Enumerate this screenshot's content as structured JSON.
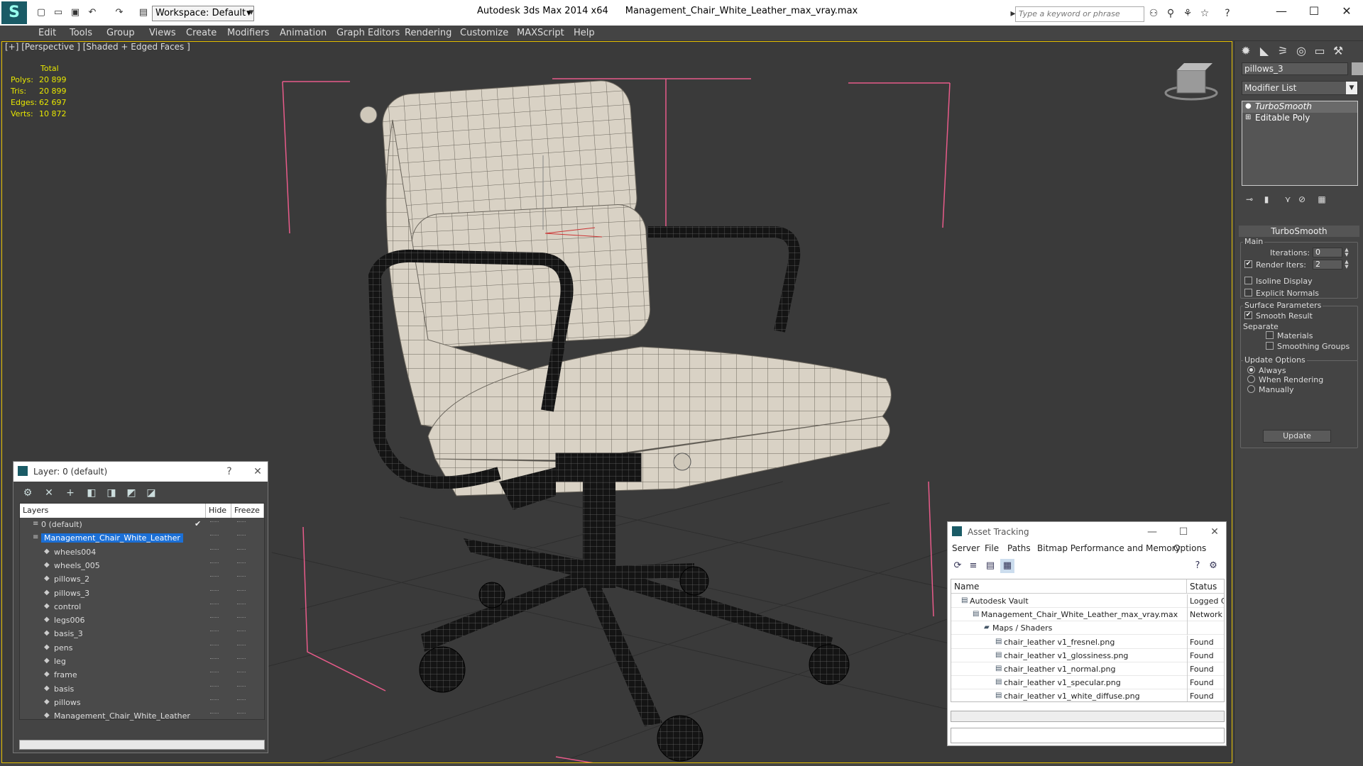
{
  "title_bar": {
    "app": "Autodesk 3ds Max  2014 x64",
    "file": "Management_Chair_White_Leather_max_vray.max",
    "workspace": "Workspace: Default",
    "search_placeholder": "Type a keyword or phrase"
  },
  "menu": [
    "Edit",
    "Tools",
    "Group",
    "Views",
    "Create",
    "Modifiers",
    "Animation",
    "Graph Editors",
    "Rendering",
    "Customize",
    "MAXScript",
    "Help"
  ],
  "viewport": {
    "label": "[+] [Perspective ] [Shaded + Edged Faces ]",
    "stats": {
      "header": "Total",
      "rows": [
        {
          "k": "Polys:",
          "v": "20 899"
        },
        {
          "k": "Tris:",
          "v": "20 899"
        },
        {
          "k": "Edges:",
          "v": "62 697"
        },
        {
          "k": "Verts:",
          "v": "10 872"
        }
      ]
    }
  },
  "command_panel": {
    "object_name": "pillows_3",
    "modifier_list": "Modifier List",
    "stack": [
      "TurboSmooth",
      "Editable Poly"
    ],
    "rollout_title": "TurboSmooth",
    "main_group": "Main",
    "iterations_label": "Iterations:",
    "iterations_value": "0",
    "render_iters_label": "Render Iters:",
    "render_iters_value": "2",
    "isoline": "Isoline Display",
    "explicit_normals": "Explicit Normals",
    "surface_group": "Surface Parameters",
    "smooth_result": "Smooth Result",
    "separate": "Separate",
    "materials": "Materials",
    "smoothing_groups": "Smoothing Groups",
    "update_group": "Update Options",
    "always": "Always",
    "when_rendering": "When Rendering",
    "manually": "Manually",
    "update_btn": "Update"
  },
  "layer_dialog": {
    "title": "Layer: 0 (default)",
    "help": "?",
    "columns": [
      "Layers",
      "Hide",
      "Freeze"
    ],
    "rows": [
      {
        "name": "0 (default)",
        "level": 0
      },
      {
        "name": "Management_Chair_White_Leather",
        "level": 0
      },
      {
        "name": "wheels004",
        "level": 1
      },
      {
        "name": "wheels_005",
        "level": 1
      },
      {
        "name": "pillows_2",
        "level": 1
      },
      {
        "name": "pillows_3",
        "level": 1
      },
      {
        "name": "control",
        "level": 1
      },
      {
        "name": "legs006",
        "level": 1
      },
      {
        "name": "basis_3",
        "level": 1
      },
      {
        "name": "pens",
        "level": 1
      },
      {
        "name": "leg",
        "level": 1
      },
      {
        "name": "frame",
        "level": 1
      },
      {
        "name": "basis",
        "level": 1
      },
      {
        "name": "pillows",
        "level": 1
      },
      {
        "name": "Management_Chair_White_Leather",
        "level": 1
      }
    ]
  },
  "asset_dialog": {
    "title": "Asset Tracking",
    "menu": [
      "Server",
      "File",
      "Paths",
      "Bitmap Performance and Memory",
      "Options"
    ],
    "columns": [
      "Name",
      "Status"
    ],
    "rows": [
      {
        "name": "Autodesk Vault",
        "status": "Logged C",
        "indent": 1
      },
      {
        "name": "Management_Chair_White_Leather_max_vray.max",
        "status": "Network",
        "indent": 2
      },
      {
        "name": "Maps / Shaders",
        "status": "",
        "indent": 3
      },
      {
        "name": "chair_leather v1_fresnel.png",
        "status": "Found",
        "indent": 4
      },
      {
        "name": "chair_leather v1_glossiness.png",
        "status": "Found",
        "indent": 4
      },
      {
        "name": "chair_leather v1_normal.png",
        "status": "Found",
        "indent": 4
      },
      {
        "name": "chair_leather v1_specular.png",
        "status": "Found",
        "indent": 4
      },
      {
        "name": "chair_leather v1_white_diffuse.png",
        "status": "Found",
        "indent": 4
      }
    ]
  },
  "colors": {
    "viewport_bg": "#3a3a3a",
    "stats": "#e6e600",
    "selection": "#1b6fd6",
    "bbox": "#e85b8a",
    "chair_white": "#d9d2c5",
    "frame_black": "#111111"
  }
}
